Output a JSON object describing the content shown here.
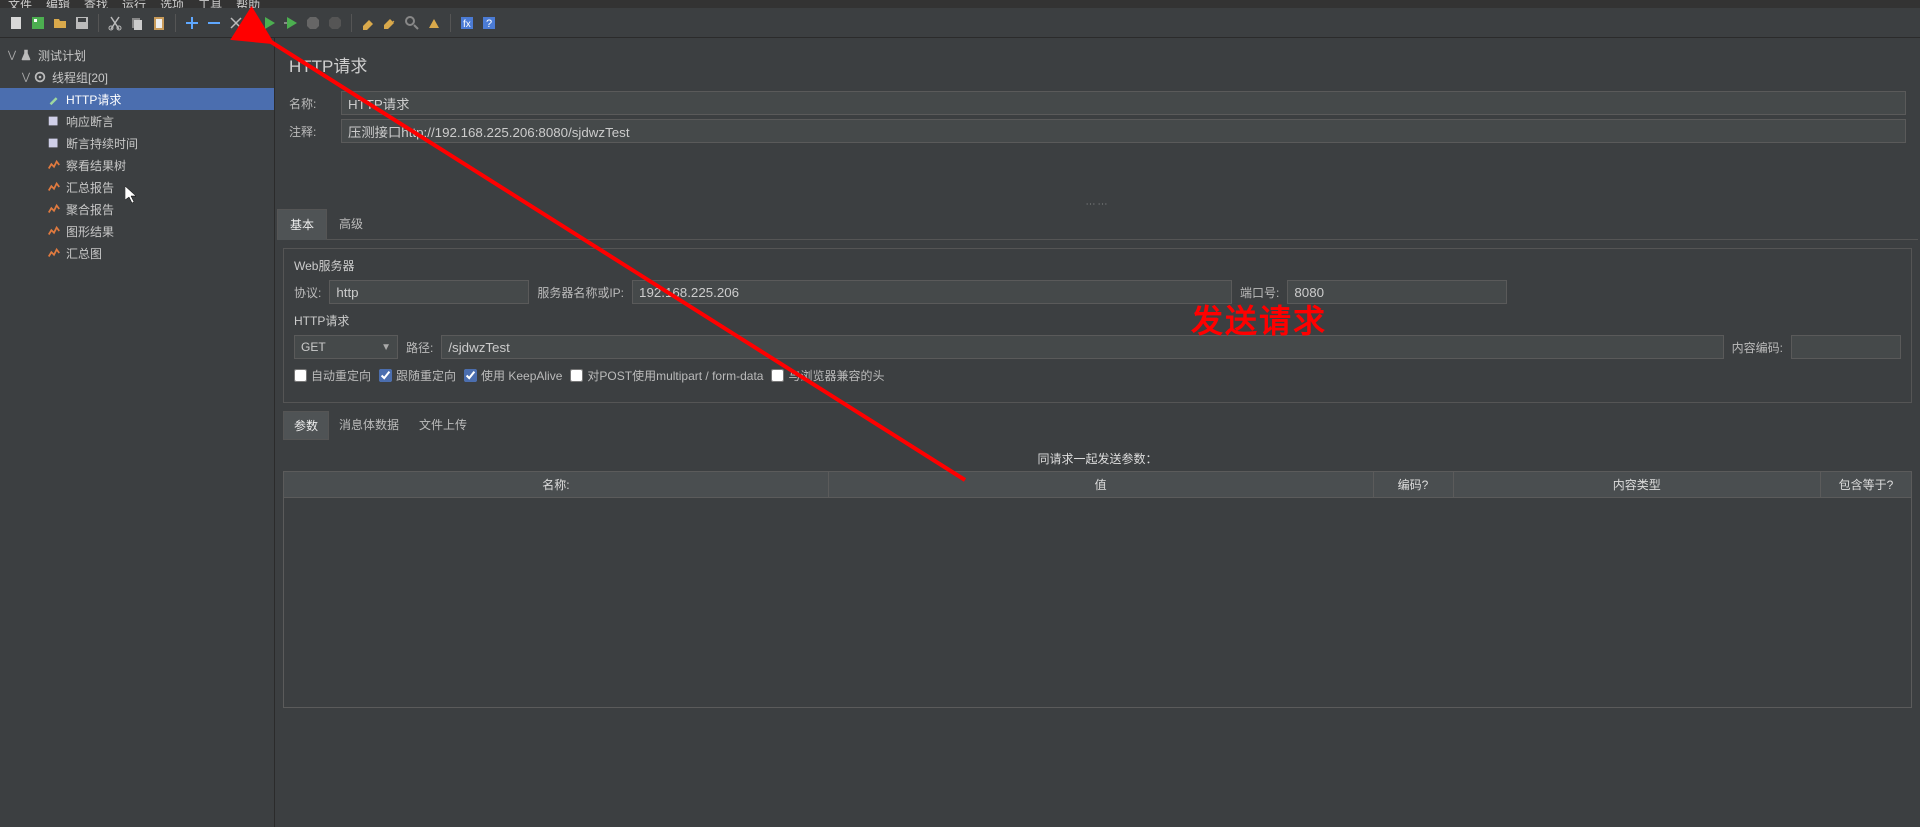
{
  "menu": {
    "items": [
      "文件",
      "编辑",
      "查找",
      "运行",
      "选项",
      "工具",
      "帮助"
    ]
  },
  "tree": {
    "root": "测试计划",
    "group": "线程组[20]",
    "items": [
      "HTTP请求",
      "响应断言",
      "断言持续时间",
      "察看结果树",
      "汇总报告",
      "聚合报告",
      "图形结果",
      "汇总图"
    ]
  },
  "panel": {
    "title": "HTTP请求",
    "name_label": "名称:",
    "name_value": "HTTP请求",
    "comment_label": "注释:",
    "comment_value": "压测接口http://192.168.225.206:8080/sjdwzTest",
    "tabs": {
      "basic": "基本",
      "advanced": "高级"
    },
    "web_section": "Web服务器",
    "protocol_label": "协议:",
    "protocol_value": "http",
    "server_label": "服务器名称或IP:",
    "server_value": "192.168.225.206",
    "port_label": "端口号:",
    "port_value": "8080",
    "http_section": "HTTP请求",
    "method": "GET",
    "path_label": "路径:",
    "path_value": "/sjdwzTest",
    "encoding_label": "内容编码:",
    "encoding_value": "",
    "cb1": "自动重定向",
    "cb2": "跟随重定向",
    "cb3": "使用 KeepAlive",
    "cb4": "对POST使用multipart / form-data",
    "cb5": "与浏览器兼容的头",
    "inner_tabs": {
      "params": "参数",
      "body": "消息体数据",
      "upload": "文件上传"
    },
    "params_title": "同请求一起发送参数：",
    "cols": {
      "name": "名称:",
      "value": "值",
      "enc": "编码?",
      "ct": "内容类型",
      "eq": "包含等于?"
    }
  },
  "annotation": "发送请求"
}
